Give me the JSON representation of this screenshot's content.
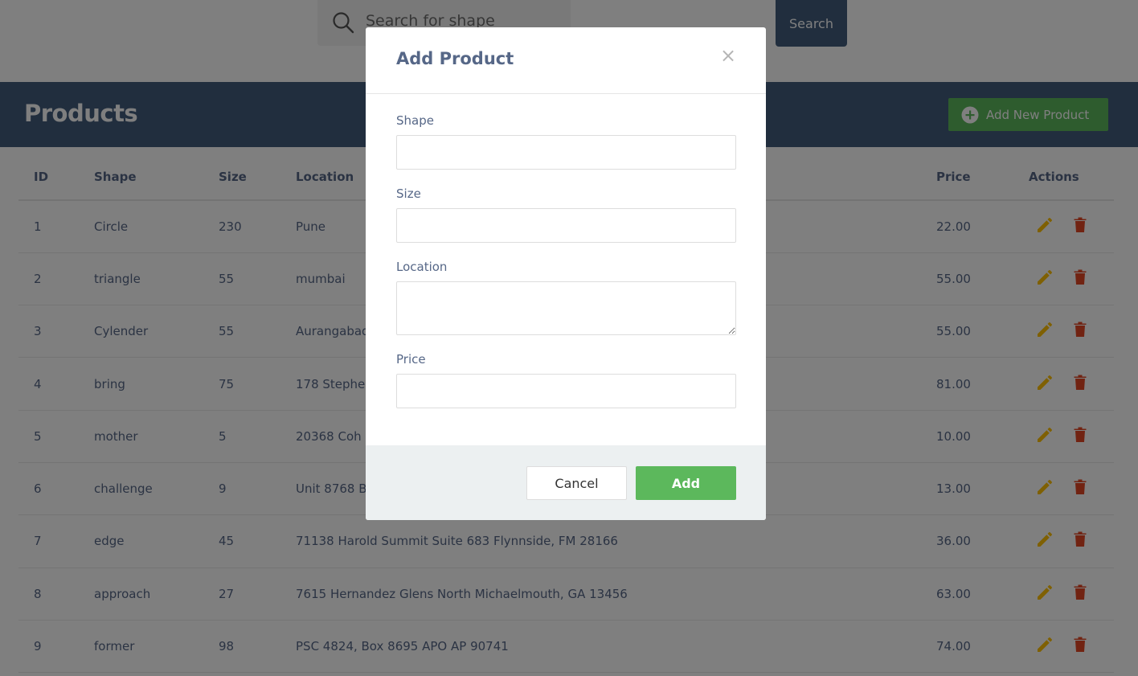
{
  "search": {
    "placeholder": "Search for shape",
    "button_label": "Search"
  },
  "header": {
    "title": "Products",
    "add_button_label": "Add New Product"
  },
  "table": {
    "columns": [
      "ID",
      "Shape",
      "Size",
      "Location",
      "Price",
      "Actions"
    ],
    "rows": [
      {
        "id": "1",
        "shape": "Circle",
        "size": "230",
        "location": "Pune",
        "price": "22.00"
      },
      {
        "id": "2",
        "shape": "triangle",
        "size": "55",
        "location": "mumbai",
        "price": "55.00"
      },
      {
        "id": "3",
        "shape": "Cylender",
        "size": "55",
        "location": "Aurangabad",
        "price": "55.00"
      },
      {
        "id": "4",
        "shape": "bring",
        "size": "75",
        "location": "178 Stephe",
        "price": "81.00"
      },
      {
        "id": "5",
        "shape": "mother",
        "size": "5",
        "location": "20368 Coh",
        "price": "10.00"
      },
      {
        "id": "6",
        "shape": "challenge",
        "size": "9",
        "location": "Unit 8768 B",
        "price": "13.00"
      },
      {
        "id": "7",
        "shape": "edge",
        "size": "45",
        "location": "71138 Harold Summit Suite 683 Flynnside, FM 28166",
        "price": "36.00"
      },
      {
        "id": "8",
        "shape": "approach",
        "size": "27",
        "location": "7615 Hernandez Glens North Michaelmouth, GA 13456",
        "price": "63.00"
      },
      {
        "id": "9",
        "shape": "former",
        "size": "98",
        "location": "PSC 4824, Box 8695 APO AP 90741",
        "price": "74.00"
      }
    ]
  },
  "modal": {
    "title": "Add Product",
    "close_label": "×",
    "fields": {
      "shape_label": "Shape",
      "shape_value": "",
      "size_label": "Size",
      "size_value": "",
      "location_label": "Location",
      "location_value": "",
      "price_label": "Price",
      "price_value": ""
    },
    "cancel_label": "Cancel",
    "submit_label": "Add"
  },
  "colors": {
    "header_bg": "#435d7d",
    "success": "#5cb85c",
    "edit_icon": "#FFC107",
    "delete_icon": "#E34724",
    "text": "#566787"
  },
  "icons": {
    "search": "search-icon",
    "add": "plus-circle-icon",
    "edit": "pencil-icon",
    "delete": "trash-icon"
  }
}
